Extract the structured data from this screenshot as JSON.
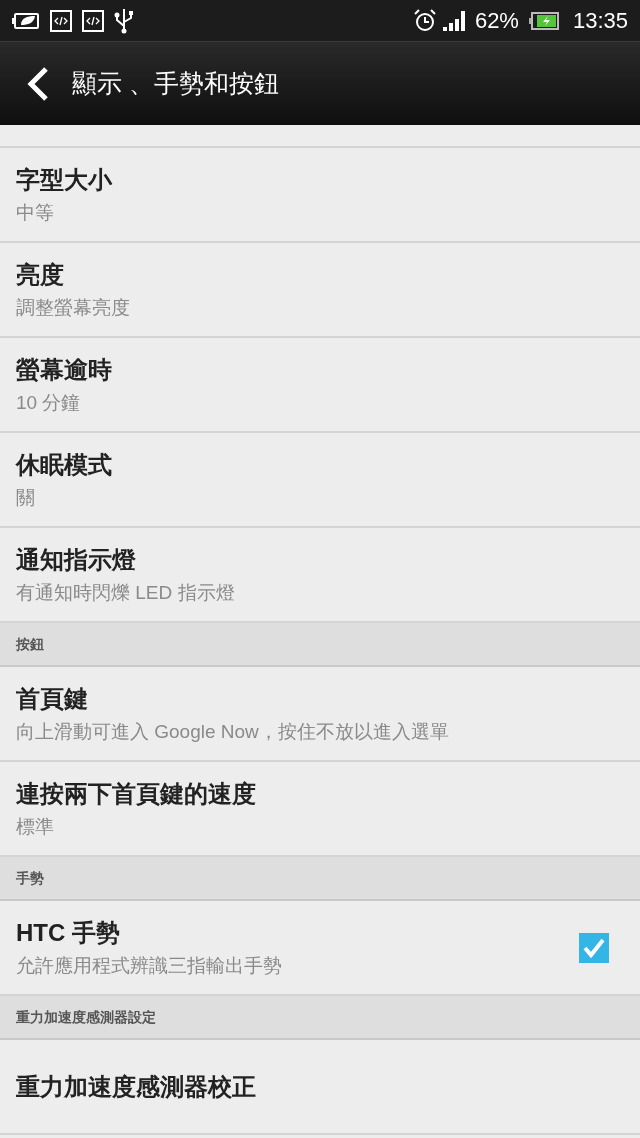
{
  "status_bar": {
    "battery": "62%",
    "time": "13:35"
  },
  "header": {
    "title": "顯示 、手勢和按鈕"
  },
  "list": [
    {
      "kind": "item",
      "title": "字型大小",
      "subtitle": "中等"
    },
    {
      "kind": "item",
      "title": "亮度",
      "subtitle": "調整螢幕亮度"
    },
    {
      "kind": "item",
      "title": "螢幕逾時",
      "subtitle": "10 分鐘"
    },
    {
      "kind": "item",
      "title": "休眠模式",
      "subtitle": "關"
    },
    {
      "kind": "item",
      "title": "通知指示燈",
      "subtitle": "有通知時閃爍 LED 指示燈"
    },
    {
      "kind": "header",
      "title": "按鈕"
    },
    {
      "kind": "item",
      "title": "首頁鍵",
      "subtitle": "向上滑動可進入 Google Now，按住不放以進入選單"
    },
    {
      "kind": "item",
      "title": "連按兩下首頁鍵的速度",
      "subtitle": "標準"
    },
    {
      "kind": "header",
      "title": "手勢"
    },
    {
      "kind": "check",
      "title": "HTC 手勢",
      "subtitle": "允許應用程式辨識三指輸出手勢",
      "checked": true
    },
    {
      "kind": "header",
      "title": "重力加速度感測器設定"
    },
    {
      "kind": "item",
      "title": "重力加速度感測器校正"
    }
  ]
}
